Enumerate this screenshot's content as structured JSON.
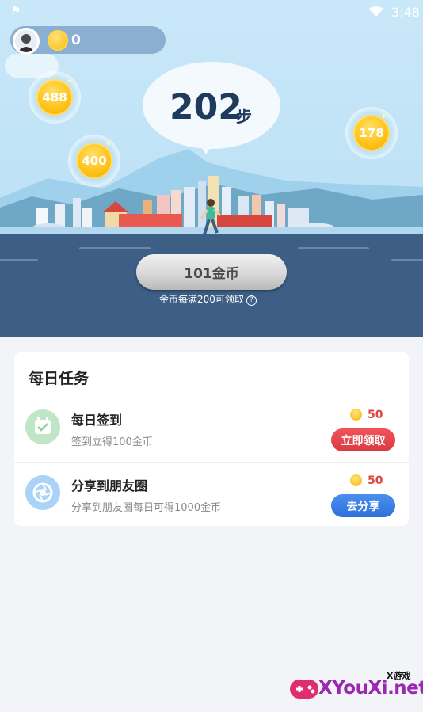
{
  "status_bar": {
    "time": "3:48",
    "icons": [
      "notification-icon",
      "wifi-icon",
      "battery-icon"
    ]
  },
  "user": {
    "coin_balance": "0"
  },
  "bubbles": [
    {
      "value": "488"
    },
    {
      "value": "400"
    },
    {
      "value": "178"
    }
  ],
  "steps": {
    "value": "202",
    "unit": "步"
  },
  "claim": {
    "button_label": "101金币",
    "hint": "金币每满200可领取"
  },
  "daily_tasks": {
    "title": "每日任务",
    "items": [
      {
        "name": "每日签到",
        "description": "签到立得100金币",
        "reward": "50",
        "button": "立即领取",
        "icon": "calendar-check-icon",
        "button_color": "#e2473f"
      },
      {
        "name": "分享到朋友圈",
        "description": "分享到朋友圈每日可得1000金币",
        "reward": "50",
        "button": "去分享",
        "icon": "camera-aperture-icon",
        "button_color": "#3b7fe6"
      }
    ]
  },
  "watermark": {
    "small": "X游戏",
    "main": "XYouXi.net"
  },
  "colors": {
    "sky": "#c4e5f8",
    "ground": "#3d5f86",
    "step_text": "#1e3a5c",
    "coin": "#ffc21a"
  }
}
